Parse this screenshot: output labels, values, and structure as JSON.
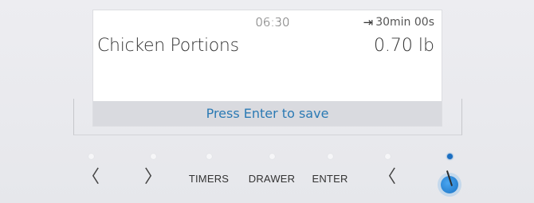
{
  "display": {
    "time": "06:30",
    "duration_icon": "arrow-to-bar-icon",
    "duration": "30min 00s",
    "food_name": "Chicken Portions",
    "weight": "0.70 lb",
    "status": "Press Enter to save"
  },
  "controls": [
    {
      "id": "left-1",
      "glyph": "〈",
      "icon": "chevron-left-icon",
      "led_on": false
    },
    {
      "id": "right-1",
      "glyph": "〉",
      "icon": "chevron-right-icon",
      "led_on": false
    },
    {
      "id": "timers",
      "label": "TIMERS",
      "led_on": false
    },
    {
      "id": "drawer",
      "label": "DRAWER",
      "led_on": false
    },
    {
      "id": "enter",
      "label": "ENTER",
      "led_on": false
    },
    {
      "id": "left-2",
      "glyph": "〈",
      "icon": "chevron-left-icon",
      "led_on": false
    },
    {
      "id": "knob",
      "icon": "knob-icon",
      "led_on": true
    }
  ],
  "colors": {
    "accent": "#1c6fc2",
    "status_text": "#2b7ab4",
    "status_bar": "#d9dadf"
  }
}
